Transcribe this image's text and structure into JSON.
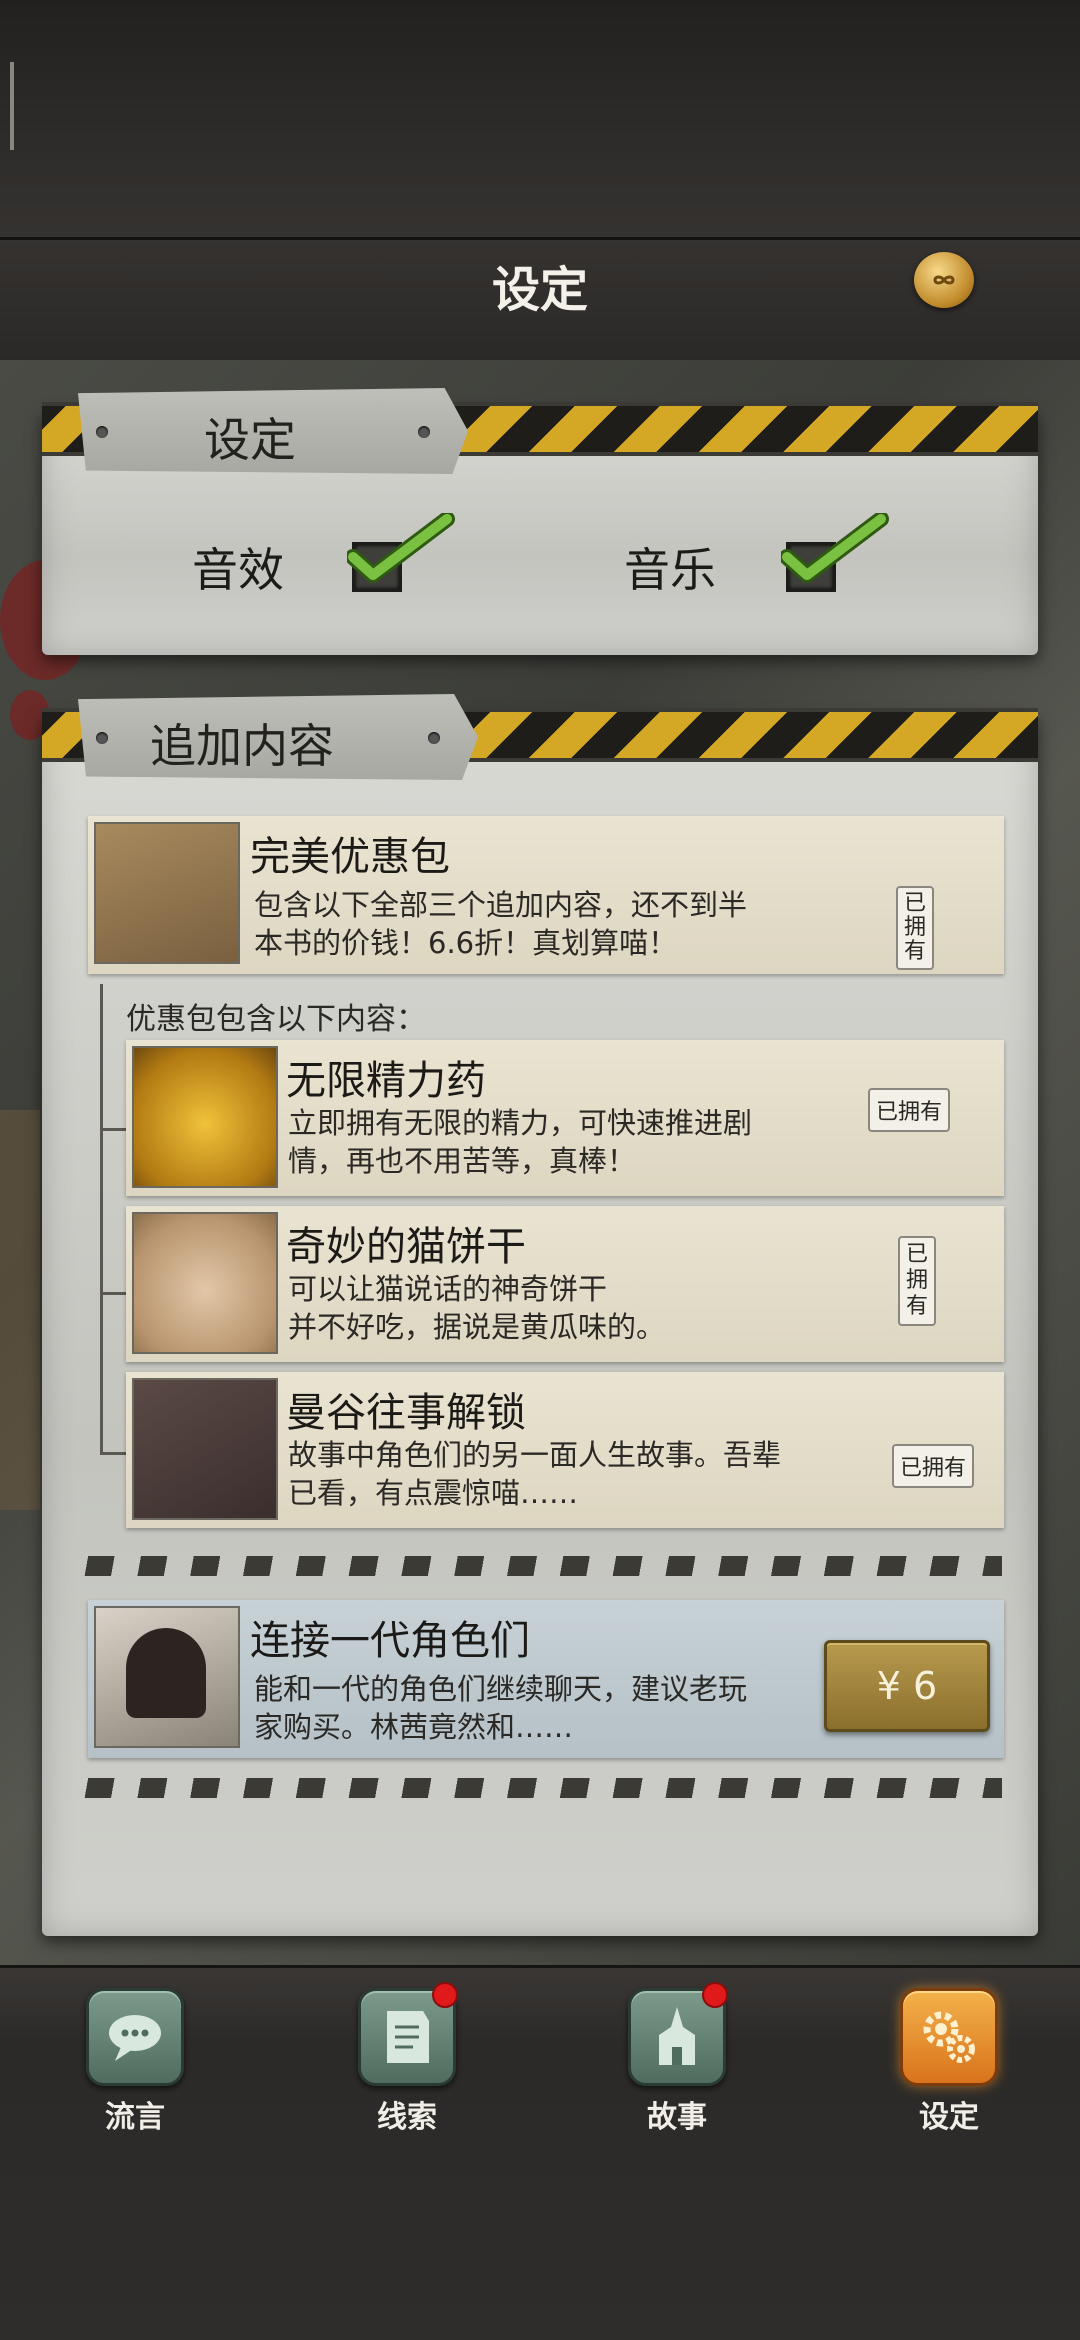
{
  "header": {
    "title": "设定"
  },
  "settings_panel": {
    "tab_label": "设定",
    "sound_effects": {
      "label": "音效",
      "checked": true
    },
    "music": {
      "label": "音乐",
      "checked": true
    }
  },
  "addons_panel": {
    "tab_label": "追加内容",
    "bundle": {
      "title": "完美优惠包",
      "desc_line1": "包含以下全部三个追加内容，还不到半",
      "desc_line2": "本书的价钱！6.6折！真划算喵！",
      "owned": "已拥有"
    },
    "bundle_contents_label": "优惠包包含以下内容：",
    "items": [
      {
        "title": "无限精力药",
        "desc_line1": "立即拥有无限的精力，可快速推进剧",
        "desc_line2": "情，再也不用苦等，真棒！",
        "owned": "已拥有"
      },
      {
        "title": "奇妙的猫饼干",
        "desc_line1": "可以让猫说话的神奇饼干",
        "desc_line2": "并不好吃，据说是黄瓜味的。",
        "owned": "已拥有"
      },
      {
        "title": "曼谷往事解锁",
        "desc_line1": "故事中角色们的另一面人生故事。吾辈",
        "desc_line2": "已看，有点震惊喵……",
        "owned": "已拥有"
      }
    ],
    "paid_item": {
      "title": "连接一代角色们",
      "desc_line1": "能和一代的角色们继续聊天，建议老玩",
      "desc_line2": "家购买。林茜竟然和……",
      "price": "¥ 6"
    }
  },
  "bottom_nav": [
    {
      "label": "流言",
      "icon": "chat-bubble-icon",
      "badge": false,
      "active": false
    },
    {
      "label": "线索",
      "icon": "paper-icon",
      "badge": true,
      "active": false
    },
    {
      "label": "故事",
      "icon": "temple-icon",
      "badge": true,
      "active": false
    },
    {
      "label": "设定",
      "icon": "gear-icon",
      "badge": false,
      "active": true
    }
  ],
  "colors": {
    "accent_gold": "#d4a824",
    "nav_active": "#e8901f",
    "check_green": "#7ac142",
    "badge_red": "#e01a1a"
  }
}
